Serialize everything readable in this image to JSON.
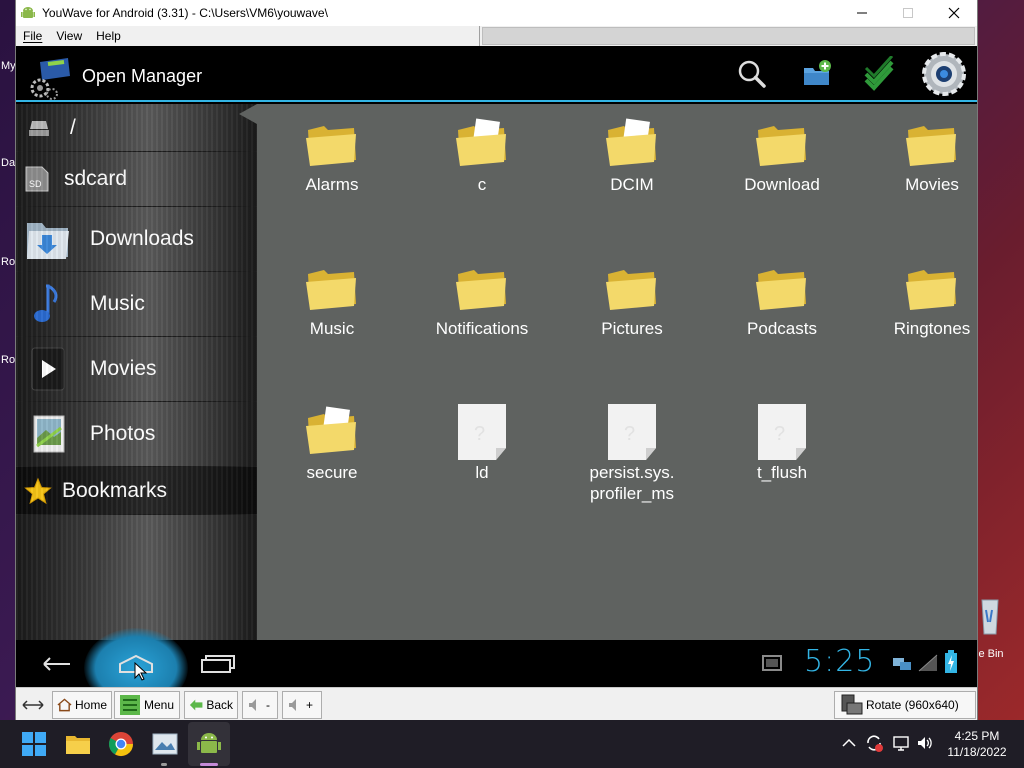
{
  "desktop": {
    "fragments": [
      "My",
      "Da",
      "Ro",
      "Ro"
    ],
    "recycle_bin_label": "le Bin"
  },
  "window": {
    "title": "YouWave for Android (3.31) - C:\\Users\\VM6\\youwave\\",
    "menus": [
      "File",
      "View",
      "Help"
    ]
  },
  "app": {
    "title": "Open Manager",
    "actions": [
      "search-icon",
      "new-folder-icon",
      "multi-select-icon",
      "settings-icon"
    ],
    "accent": "#33b5e5"
  },
  "sidebar": {
    "items": [
      {
        "label": "/",
        "icon": "drive-icon"
      },
      {
        "label": "sdcard",
        "icon": "sd-card-icon"
      },
      {
        "label": "Downloads",
        "icon": "downloads-folder-icon"
      },
      {
        "label": "Music",
        "icon": "music-note-icon"
      },
      {
        "label": "Movies",
        "icon": "movie-play-icon"
      },
      {
        "label": "Photos",
        "icon": "photo-icon"
      },
      {
        "label": "Bookmarks",
        "icon": "star-icon"
      }
    ]
  },
  "files": [
    {
      "name": "Alarms",
      "type": "folder"
    },
    {
      "name": "c",
      "type": "folder-doc"
    },
    {
      "name": "DCIM",
      "type": "folder-doc"
    },
    {
      "name": "Download",
      "type": "folder"
    },
    {
      "name": "Movies",
      "type": "folder"
    },
    {
      "name": "Music",
      "type": "folder"
    },
    {
      "name": "Notifications",
      "type": "folder"
    },
    {
      "name": "Pictures",
      "type": "folder"
    },
    {
      "name": "Podcasts",
      "type": "folder"
    },
    {
      "name": "Ringtones",
      "type": "folder"
    },
    {
      "name": "secure",
      "type": "folder-doc"
    },
    {
      "name": "ld",
      "type": "file"
    },
    {
      "name": "persist.sys.\nprofiler_ms",
      "type": "file"
    },
    {
      "name": "t_flush",
      "type": "file"
    }
  ],
  "navbar": {
    "clock": "5:25",
    "buttons": [
      "back-icon",
      "home-icon",
      "recent-apps-icon"
    ]
  },
  "toolbar": {
    "home": "Home",
    "menu": "Menu",
    "back": "Back",
    "vol_down": "-",
    "vol_up": "+",
    "rotate": "Rotate (960x640)"
  },
  "taskbar": {
    "time": "4:25 PM",
    "date": "11/18/2022"
  }
}
